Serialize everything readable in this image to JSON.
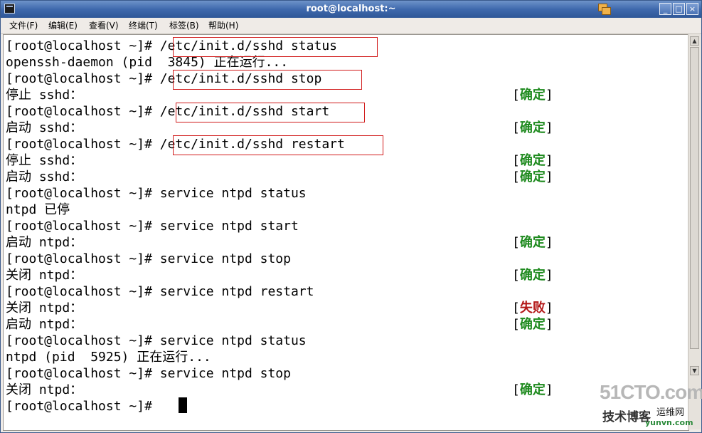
{
  "window": {
    "title": "root@localhost:~"
  },
  "menu": [
    "文件(F)",
    "编辑(E)",
    "查看(V)",
    "终端(T)",
    "标签(B)",
    "帮助(H)"
  ],
  "terminal": {
    "lines": [
      {
        "text": "[root@localhost ~]# /etc/init.d/sshd status",
        "status": ""
      },
      {
        "text": "openssh-daemon (pid  3845) 正在运行...",
        "status": ""
      },
      {
        "text": "[root@localhost ~]# /etc/init.d/sshd stop",
        "status": ""
      },
      {
        "text": "停止 sshd：",
        "status": "确定"
      },
      {
        "text": "[root@localhost ~]# /etc/init.d/sshd start",
        "status": ""
      },
      {
        "text": "启动 sshd：",
        "status": "确定"
      },
      {
        "text": "[root@localhost ~]# /etc/init.d/sshd restart",
        "status": ""
      },
      {
        "text": "停止 sshd：",
        "status": "确定"
      },
      {
        "text": "启动 sshd：",
        "status": "确定"
      },
      {
        "text": "[root@localhost ~]# service ntpd status",
        "status": ""
      },
      {
        "text": "ntpd 已停",
        "status": ""
      },
      {
        "text": "[root@localhost ~]# service ntpd start",
        "status": ""
      },
      {
        "text": "启动 ntpd：",
        "status": "确定"
      },
      {
        "text": "[root@localhost ~]# service ntpd stop",
        "status": ""
      },
      {
        "text": "关闭 ntpd：",
        "status": "确定"
      },
      {
        "text": "[root@localhost ~]# service ntpd restart",
        "status": ""
      },
      {
        "text": "关闭 ntpd：",
        "status": "失败"
      },
      {
        "text": "启动 ntpd：",
        "status": "确定"
      },
      {
        "text": "[root@localhost ~]# service ntpd status",
        "status": ""
      },
      {
        "text": "ntpd (pid  5925) 正在运行...",
        "status": ""
      },
      {
        "text": "[root@localhost ~]# service ntpd stop",
        "status": ""
      },
      {
        "text": "关闭 ntpd：",
        "status": "确定"
      },
      {
        "text": "[root@localhost ~]# ",
        "status": ""
      }
    ]
  },
  "watermark": {
    "brand": "51CTO.com",
    "sub": "技术博客",
    "site": "运维网",
    "url": "yunvn.com"
  },
  "colors": {
    "ok": "#1e8a1e",
    "fail": "#b31818",
    "highlight": "#d11b1b",
    "titlebar": "#3f69ad"
  }
}
